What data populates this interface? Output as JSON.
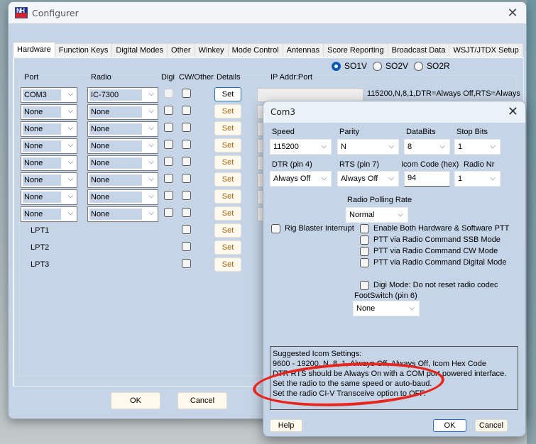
{
  "main_window": {
    "title": "Configurer",
    "logo_text": "NH",
    "close_glyph": "✕",
    "tabs": [
      {
        "label": "Hardware",
        "active": true
      },
      {
        "label": "Function Keys",
        "active": false
      },
      {
        "label": "Digital Modes",
        "active": false
      },
      {
        "label": "Other",
        "active": false
      },
      {
        "label": "Winkey",
        "active": false
      },
      {
        "label": "Mode Control",
        "active": false
      },
      {
        "label": "Antennas",
        "active": false
      },
      {
        "label": "Score Reporting",
        "active": false
      },
      {
        "label": "Broadcast Data",
        "active": false
      },
      {
        "label": "WSJT/JTDX Setup",
        "active": false
      }
    ],
    "hardware": {
      "headers": {
        "port": "Port",
        "radio": "Radio",
        "digi": "Digi",
        "cw_other": "CW/Other",
        "details": "Details",
        "ip": "IP Addr:Port"
      },
      "operation_modes": [
        {
          "label": "SO1V",
          "selected": true
        },
        {
          "label": "SO2V",
          "selected": false
        },
        {
          "label": "SO2R",
          "selected": false
        }
      ],
      "rows": [
        {
          "port": "COM3",
          "radio": "IC-7300",
          "digi": false,
          "digi_disabled": true,
          "cw_other": false,
          "set": "Set",
          "summary": "115200,N,8,1,DTR=Always Off,RTS=Always"
        },
        {
          "port": "None",
          "radio": "None",
          "digi": false,
          "cw_other": false,
          "set": "Set"
        },
        {
          "port": "None",
          "radio": "None",
          "digi": false,
          "cw_other": false,
          "set": "Set"
        },
        {
          "port": "None",
          "radio": "None",
          "digi": false,
          "cw_other": false,
          "set": "Set"
        },
        {
          "port": "None",
          "radio": "None",
          "digi": false,
          "cw_other": false,
          "set": "Set"
        },
        {
          "port": "None",
          "radio": "None",
          "digi": false,
          "cw_other": false,
          "set": "Set"
        },
        {
          "port": "None",
          "radio": "None",
          "digi": false,
          "cw_other": false,
          "set": "Set"
        },
        {
          "port": "None",
          "radio": "None",
          "digi": false,
          "cw_other": false,
          "set": "Set"
        }
      ],
      "lpt_rows": [
        {
          "label": "LPT1",
          "cw_other": false,
          "set": "Set"
        },
        {
          "label": "LPT2",
          "cw_other": false,
          "set": "Set"
        },
        {
          "label": "LPT3",
          "cw_other": false,
          "set": "Set"
        }
      ]
    },
    "buttons": {
      "ok": "OK",
      "cancel": "Cancel"
    }
  },
  "com_dialog": {
    "title": "Com3",
    "close_glyph": "✕",
    "fields": {
      "speed": {
        "label": "Speed",
        "value": "115200"
      },
      "parity": {
        "label": "Parity",
        "value": "N"
      },
      "databits": {
        "label": "DataBits",
        "value": "8"
      },
      "stopbits": {
        "label": "Stop Bits",
        "value": "1"
      },
      "dtr": {
        "label": "DTR (pin 4)",
        "value": "Always Off"
      },
      "rts": {
        "label": "RTS (pin 7)",
        "value": "Always Off"
      },
      "icom_code": {
        "label": "Icom Code (hex)",
        "value": "94"
      },
      "radio_nr": {
        "label": "Radio Nr",
        "value": "1"
      },
      "polling_rate": {
        "label": "Radio Polling Rate",
        "value": "Normal"
      },
      "footswitch": {
        "label": "FootSwitch (pin 6)",
        "value": "None"
      }
    },
    "checkboxes": {
      "rig_blaster": {
        "label": "Rig Blaster Interrupt",
        "checked": false
      },
      "both_ptt": {
        "label": "Enable Both Hardware & Software PTT",
        "checked": false
      },
      "ptt_ssb": {
        "label": "PTT via Radio Command SSB Mode",
        "checked": false
      },
      "ptt_cw": {
        "label": "PTT via Radio Command CW Mode",
        "checked": false
      },
      "ptt_digital": {
        "label": "PTT via Radio Command Digital Mode",
        "checked": false
      },
      "digi_codec": {
        "label": "Digi Mode: Do not reset radio codec",
        "checked": false
      }
    },
    "notes": [
      "Suggested Icom Settings:",
      "9600 - 19200,  N,  8,  1,  Always Off, Always Off,  Icom Hex Code",
      "DTR  RTS should be Always On with a COM port powered interface.",
      "Set the radio to the same speed or auto-baud.",
      "Set the radio CI-V Transceive option to OFF."
    ],
    "buttons": {
      "help": "Help",
      "ok": "OK",
      "cancel": "Cancel"
    }
  },
  "annotation": {
    "color": "#e8261e",
    "highlights": "Set the radio CI-V Transceive option to OFF."
  },
  "icons": {
    "chevron": "⌵"
  }
}
